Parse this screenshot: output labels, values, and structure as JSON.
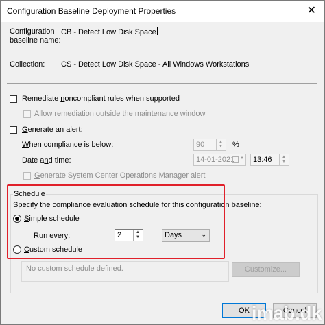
{
  "window": {
    "title": "Configuration Baseline Deployment Properties",
    "close_glyph": "✕"
  },
  "fields": {
    "baseline_name_label_line1": "Configuration",
    "baseline_name_label_line2": "baseline name:",
    "baseline_name_value": "CB - Detect Low Disk Space",
    "collection_label": "Collection:",
    "collection_value": "CS - Detect Low Disk Space - All Windows Workstations"
  },
  "options": {
    "remediate_pre": "Remediate ",
    "remediate_u": "n",
    "remediate_post": "oncompliant rules when supported",
    "allow_remediation": "Allow remediation outside the maintenance window",
    "generate_alert_u": "G",
    "generate_alert_post": "enerate an alert:",
    "compliance_pre": "",
    "compliance_u": "W",
    "compliance_post": "hen compliance is below:",
    "compliance_value": "90",
    "percent": "%",
    "date_pre": "Date a",
    "date_u": "n",
    "date_post": "d time:",
    "date_value": "14-01-2021",
    "time_value": "13:46",
    "scom_pre": "",
    "scom_u": "G",
    "scom_post": "enerate System Center Operations Manager alert"
  },
  "schedule": {
    "heading": "Schedule",
    "description": "Specify the compliance evaluation schedule for this configuration baseline:",
    "simple_u": "S",
    "simple_post": "imple schedule",
    "run_every_u": "R",
    "run_every_post": "un every:",
    "run_every_value": "2",
    "unit_value": "Days",
    "custom_u": "C",
    "custom_post": "ustom schedule",
    "no_custom": "No custom schedule defined.",
    "customize_button": "Customize..."
  },
  "footer": {
    "ok_button": "OK",
    "cancel_button": "Cancel"
  },
  "watermark": "imab.dk"
}
